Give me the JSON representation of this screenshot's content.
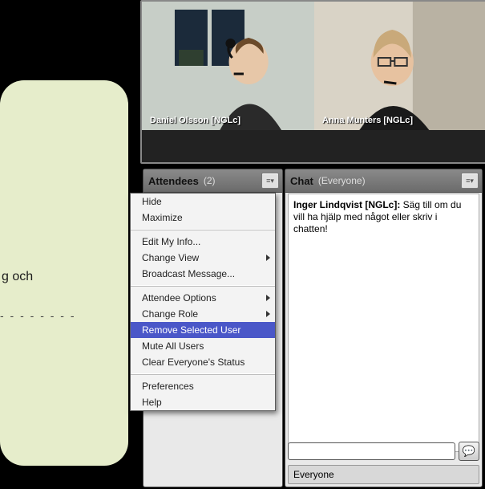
{
  "bg": {
    "text1": "g och",
    "dashes": "- - - - - - - -"
  },
  "videos": [
    {
      "label": "Daniel Olsson [NGLc]"
    },
    {
      "label": "Anna Munters [NGLc]"
    }
  ],
  "attendees_pane": {
    "title": "Attendees",
    "count": "(2)"
  },
  "chat_pane": {
    "title": "Chat",
    "scope": "(Everyone)",
    "messages": [
      {
        "name": "Inger Lindqvist [NGLc]:",
        "text": " Säg till om du vill ha hjälp med något eller skriv i chatten!"
      }
    ],
    "input_placeholder": "",
    "send_glyph": "💬",
    "scope_label": "Everyone"
  },
  "menu": {
    "items": [
      {
        "label": "Hide",
        "sub": false,
        "hl": false
      },
      {
        "label": "Maximize",
        "sub": false,
        "hl": false
      },
      {
        "sep": true
      },
      {
        "label": "Edit My Info...",
        "sub": false,
        "hl": false
      },
      {
        "label": "Change View",
        "sub": true,
        "hl": false
      },
      {
        "label": "Broadcast Message...",
        "sub": false,
        "hl": false
      },
      {
        "sep": true
      },
      {
        "label": "Attendee Options",
        "sub": true,
        "hl": false
      },
      {
        "label": "Change Role",
        "sub": true,
        "hl": false
      },
      {
        "label": "Remove Selected User",
        "sub": false,
        "hl": true
      },
      {
        "label": "Mute All Users",
        "sub": false,
        "hl": false
      },
      {
        "label": "Clear Everyone's Status",
        "sub": false,
        "hl": false
      },
      {
        "sep": true
      },
      {
        "label": "Preferences",
        "sub": false,
        "hl": false
      },
      {
        "label": "Help",
        "sub": false,
        "hl": false
      }
    ]
  }
}
